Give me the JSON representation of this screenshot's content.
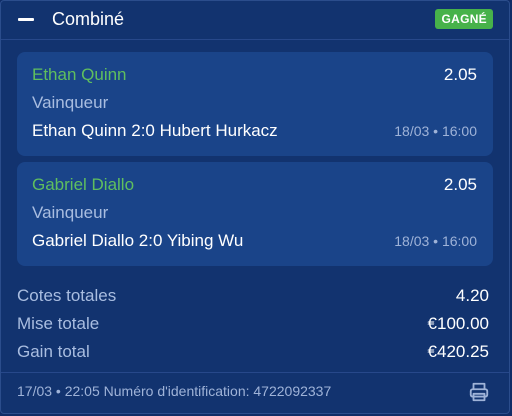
{
  "header": {
    "title": "Combiné",
    "status": "GAGNÉ",
    "status_color": "#47b24a"
  },
  "legs": [
    {
      "player": "Ethan Quinn",
      "odds": "2.05",
      "market": "Vainqueur",
      "match": "Ethan Quinn 2:0 Hubert Hurkacz",
      "datetime": "18/03 • 16:00"
    },
    {
      "player": "Gabriel Diallo",
      "odds": "2.05",
      "market": "Vainqueur",
      "match": "Gabriel Diallo 2:0 Yibing Wu",
      "datetime": "18/03 • 16:00"
    }
  ],
  "totals": {
    "odds_label": "Cotes totales",
    "odds_value": "4.20",
    "stake_label": "Mise totale",
    "stake_value": "€100.00",
    "win_label": "Gain total",
    "win_value": "€420.25"
  },
  "footer": {
    "text": "17/03 • 22:05  Numéro d'identification: 4722092337",
    "icons": [
      "collapse-icon",
      "printer-icon"
    ]
  },
  "colors": {
    "background": "#12336f",
    "leg_background": "#1a4489",
    "winner_name": "#5fbf5e"
  }
}
